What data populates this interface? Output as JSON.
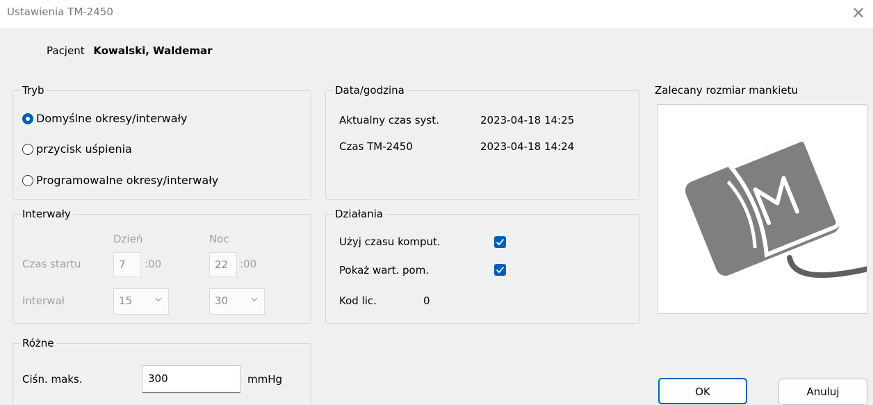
{
  "window": {
    "title": "Ustawienia TM-2450",
    "close_glyph": "✕"
  },
  "patient": {
    "label": "Pacjent",
    "name": "Kowalski, Waldemar"
  },
  "mode": {
    "legend": "Tryb",
    "options": [
      {
        "label": "Domyślne okresy/interwały",
        "selected": true
      },
      {
        "label": "przycisk uśpienia",
        "selected": false
      },
      {
        "label": "Programowalne okresy/interwały",
        "selected": false
      }
    ]
  },
  "datetime": {
    "legend": "Data/godzina",
    "rows": [
      {
        "label": "Aktualny czas syst.",
        "value": "2023-04-18 14:25"
      },
      {
        "label": "Czas TM-2450",
        "value": "2023-04-18 14:24"
      }
    ]
  },
  "cuff": {
    "legend": "Zalecany rozmiar mankietu",
    "size_letter": "M",
    "icon": "cuff-icon"
  },
  "intervals": {
    "legend": "Interwały",
    "col_day": "Dzień",
    "col_night": "Noc",
    "start_label": "Czas startu",
    "start_day": "7",
    "start_night": "22",
    "minutes_suffix": ":00",
    "interval_label": "Interwał",
    "interval_day": "15",
    "interval_night": "30"
  },
  "actions": {
    "legend": "Działania",
    "use_computer_time": "Użyj czasu komput.",
    "show_values": "Pokaż wart. pom.",
    "license_label": "Kod lic.",
    "license_value": "0"
  },
  "misc": {
    "legend": "Różne",
    "max_pressure_label": "Ciśn. maks.",
    "max_pressure_value": "300",
    "unit": "mmHg"
  },
  "buttons": {
    "ok": "OK",
    "cancel": "Anuluj"
  },
  "colors": {
    "accent": "#005fb8",
    "background": "#f0f0f0",
    "cuff_gray": "#7f7f7f"
  }
}
